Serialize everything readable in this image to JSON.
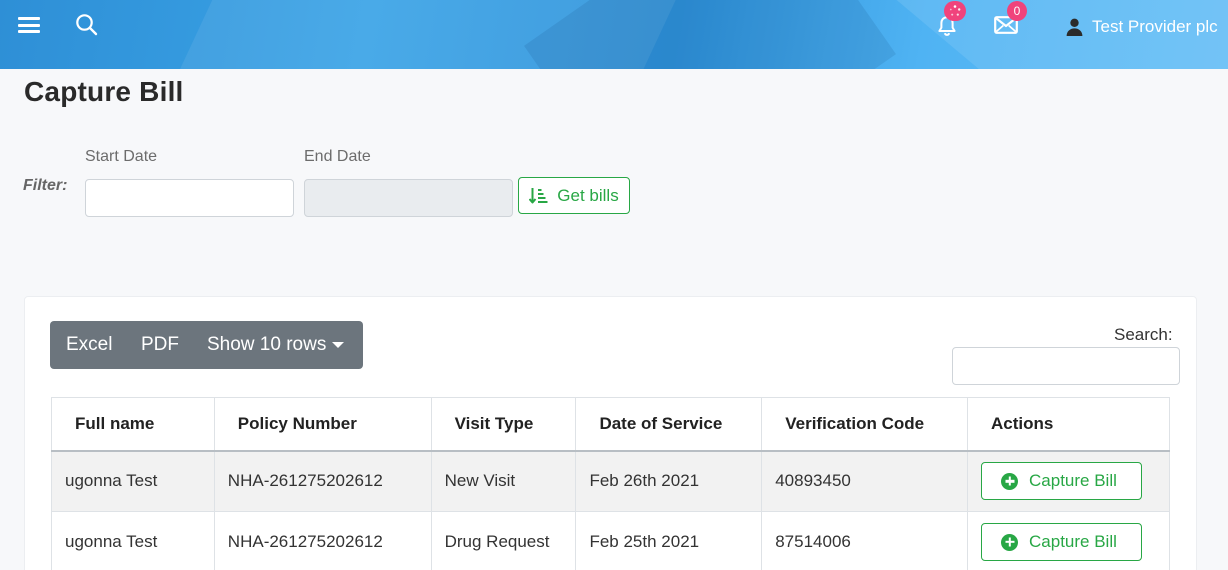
{
  "header": {
    "notifications_badge": "",
    "messages_badge": "0",
    "user_name": "Test Provider plc",
    "icons": {
      "menu": "hamburger-icon",
      "search": "search-icon",
      "notifications": "bell-icon",
      "messages": "envelope-icon",
      "user": "user-icon"
    }
  },
  "page": {
    "title": "Capture Bill"
  },
  "filter": {
    "label": "Filter:",
    "start_date_label": "Start Date",
    "start_date_value": "",
    "end_date_label": "End Date",
    "end_date_value": "",
    "get_bills_label": "Get bills",
    "get_bills_icon": "sort-amount-down-icon"
  },
  "toolbar": {
    "excel_label": "Excel",
    "pdf_label": "PDF",
    "rows_label": "Show 10 rows",
    "search_label": "Search:",
    "search_value": ""
  },
  "table": {
    "columns": [
      "Full name",
      "Policy Number",
      "Visit Type",
      "Date of Service",
      "Verification Code",
      "Actions"
    ],
    "rows": [
      {
        "full_name": "ugonna Test",
        "policy_number": "NHA-261275202612",
        "visit_type": "New Visit",
        "date_of_service": "Feb 26th 2021",
        "verification_code": "40893450",
        "action_label": "Capture Bill"
      },
      {
        "full_name": "ugonna Test",
        "policy_number": "NHA-261275202612",
        "visit_type": "Drug Request",
        "date_of_service": "Feb 25th 2021",
        "verification_code": "87514006",
        "action_label": "Capture Bill"
      }
    ]
  },
  "colors": {
    "header_gradient_start": "#2e8fd6",
    "header_gradient_end": "#63bdf5",
    "badge": "#f0437c",
    "success": "#28a745",
    "toolbar_gray": "#6c757d",
    "stripe": "#f2f2f2"
  }
}
